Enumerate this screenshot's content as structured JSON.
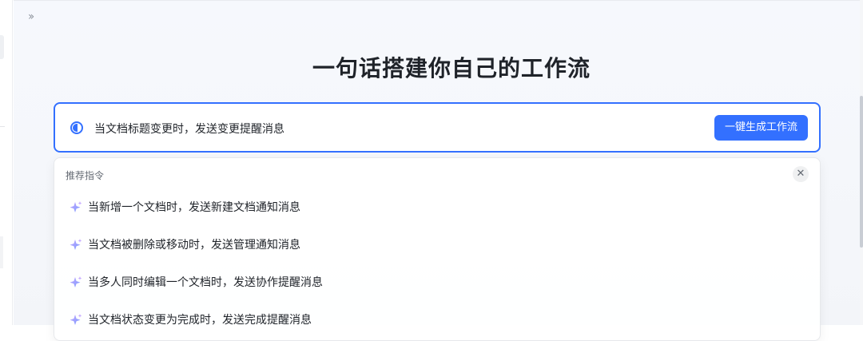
{
  "sidebar": {
    "expand_icon": "double-chevron-right-icon",
    "expand_glyph": "›› "
  },
  "main": {
    "title": "一句话搭建你自己的工作流",
    "input": {
      "value": "当文档标题变更时，发送变更提醒消息",
      "generate_button_label": "一键生成工作流"
    },
    "suggestions": {
      "header": "推荐指令",
      "close_glyph": "✕",
      "items": [
        {
          "label": "当新增一个文档时，发送新建文档通知消息"
        },
        {
          "label": "当文档被删除或移动时，发送管理通知消息"
        },
        {
          "label": "当多人同时编辑一个文档时，发送协作提醒消息"
        },
        {
          "label": "当文档状态变更为完成时，发送完成提醒消息"
        }
      ]
    }
  },
  "colors": {
    "accent": "#3370ff",
    "sparkle_start": "#b49cff",
    "sparkle_end": "#7b9cff"
  }
}
